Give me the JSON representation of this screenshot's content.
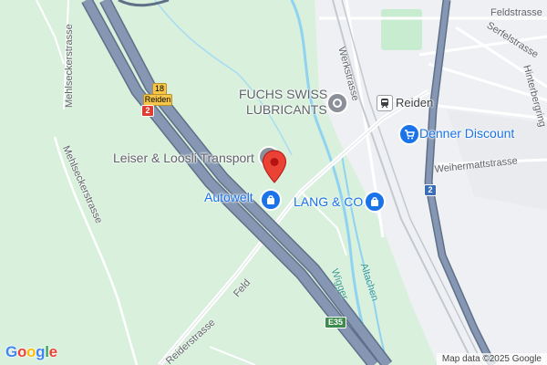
{
  "map": {
    "pois": {
      "fuchs_line1": "FUCHS SWISS",
      "fuchs_line2": "LUBRICANTS",
      "leiser": "Leiser & Loosli Transport",
      "autowelt": "Autowelt",
      "lang": "LANG & CO.",
      "denner": "Denner Discount",
      "reiden_station": "Reiden"
    },
    "streets": {
      "mehlsecker1": "Mehlseckerstrasse",
      "mehlsecker2": "Mehlseckerstrasse",
      "werkstrasse": "Werkstrasse",
      "feldstrasse": "Feldstrasse",
      "serfelstrasse": "Serfelstrasse",
      "hinterbergring": "Hinterbergring",
      "weihermattstrasse": "Weihermattstrasse",
      "reiderstrasse": "Reiderstrasse",
      "feld": "Feld"
    },
    "waterways": {
      "wigger": "Wigger",
      "altachen": "Altachen"
    },
    "badges": {
      "route18": "18",
      "route18_name": "Reiden",
      "route2_left": "2",
      "route2_right": "2",
      "e35": "E35"
    },
    "attribution": "Map data ©2025 Google",
    "logo": [
      "G",
      "o",
      "o",
      "g",
      "l",
      "e"
    ],
    "colors": {
      "land": "#d8f0dc",
      "urban": "#eef0f3",
      "highway": "#7d8fa9",
      "highway_border": "#5f6f88",
      "water": "#8fd3f0",
      "pin": "#ea4335",
      "poi_blue": "#1a73e8"
    },
    "icons": [
      "map-pin-icon",
      "shopping-bag-icon",
      "shopping-cart-icon",
      "train-station-icon",
      "generic-poi-icon"
    ]
  }
}
